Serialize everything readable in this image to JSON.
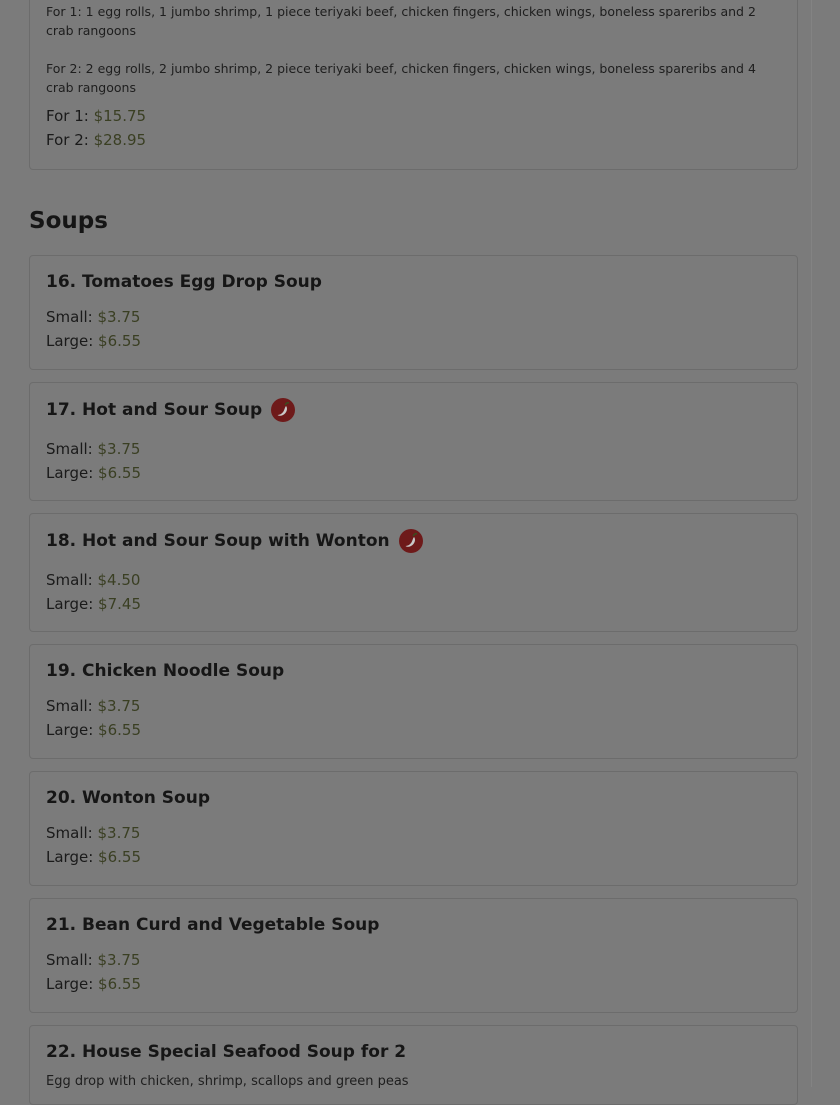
{
  "combo": {
    "for1_desc": "For 1: 1 egg rolls, 1 jumbo shrimp, 1 piece teriyaki beef, chicken fingers, chicken wings, boneless spareribs and 2 crab rangoons",
    "for2_desc": "For 2: 2 egg rolls, 2 jumbo shrimp, 2 piece teriyaki beef, chicken fingers, chicken wings, boneless spareribs and 4 crab rangoons",
    "prices": [
      {
        "label": "For 1:",
        "amount": "$15.75"
      },
      {
        "label": "For 2:",
        "amount": "$28.95"
      }
    ]
  },
  "section": {
    "title": "Soups"
  },
  "items": [
    {
      "title": "16. Tomatoes Egg Drop Soup",
      "spicy": false,
      "small": "$3.75",
      "large": "$6.55"
    },
    {
      "title": "17. Hot and Sour Soup",
      "spicy": true,
      "small": "$3.75",
      "large": "$6.55"
    },
    {
      "title": "18. Hot and Sour Soup with Wonton",
      "spicy": true,
      "small": "$4.50",
      "large": "$7.45"
    },
    {
      "title": "19. Chicken Noodle Soup",
      "spicy": false,
      "small": "$3.75",
      "large": "$6.55"
    },
    {
      "title": "20. Wonton Soup",
      "spicy": false,
      "small": "$3.75",
      "large": "$6.55"
    },
    {
      "title": "21. Bean Curd and Vegetable Soup",
      "spicy": false,
      "small": "$3.75",
      "large": "$6.55"
    },
    {
      "title": "22. House Special Seafood Soup for 2",
      "spicy": false,
      "description": "Egg drop with chicken, shrimp, scallops and green peas"
    }
  ],
  "labels": {
    "small": "Small:",
    "large": "Large:"
  },
  "icons": {
    "spicy": "chili-pepper-icon"
  },
  "colors": {
    "background": "#7b7b7b",
    "price": "#3a3f23",
    "spicy_badge": "#6e1a1a"
  }
}
